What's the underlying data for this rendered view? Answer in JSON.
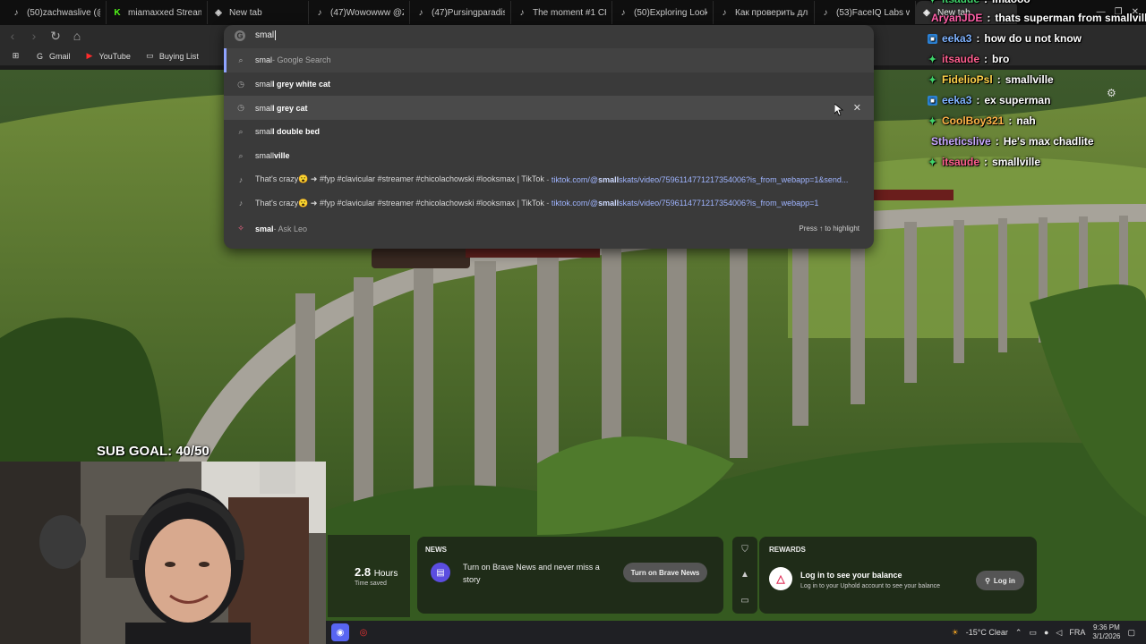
{
  "tabs": [
    {
      "label": "(50)zachwaslive (@zac",
      "icon": "tiktok-icon"
    },
    {
      "label": "miamaxxed Stream - W",
      "icon": "kick-icon"
    },
    {
      "label": "New tab",
      "icon": "brave-icon"
    },
    {
      "label": "(47)Wowowww @Zeta",
      "icon": "tiktok-icon"
    },
    {
      "label": "(47)Pursingparadise (@",
      "icon": "tiktok-icon"
    },
    {
      "label": "The moment #1 CHAD",
      "icon": "tiktok-icon"
    },
    {
      "label": "(50)Exploring Looks M",
      "icon": "tiktok-icon"
    },
    {
      "label": "Как проверить длину",
      "icon": "tiktok-icon"
    },
    {
      "label": "(53)FaceIQ Labs w",
      "icon": "tiktok-icon"
    },
    {
      "label": "New tab",
      "icon": "brave-icon",
      "active": true
    }
  ],
  "bookmarks": [
    {
      "label": "Gmail",
      "icon": "google-icon"
    },
    {
      "label": "YouTube",
      "icon": "youtube-icon"
    },
    {
      "label": "Buying List",
      "icon": "folder-icon"
    }
  ],
  "omnibox": {
    "value": "smal",
    "suggestions": [
      {
        "icon": "search-icon",
        "typed": "smal",
        "bold": "",
        "desc": " - Google Search"
      },
      {
        "icon": "history-icon",
        "typed": "smal",
        "bold": "l grey white cat",
        "desc": ""
      },
      {
        "icon": "history-icon",
        "typed": "smal",
        "bold": "l grey cat",
        "desc": ""
      },
      {
        "icon": "search-icon",
        "typed": "smal",
        "bold": "l double bed",
        "desc": ""
      },
      {
        "icon": "search-icon",
        "typed": "small",
        "bold": "ville",
        "desc": ""
      },
      {
        "icon": "tiktok-icon",
        "title": "That's crazy😮 ➜ #fyp #clavicular #streamer #chicolachowski #looksmax | TikTok",
        "url_pre": "tiktok.com/@",
        "url_bold": "small",
        "url_post": "skats/video/7596114771217354006?is_from_webapp=1&send..."
      },
      {
        "icon": "tiktok-icon",
        "title": "That's crazy😮 ➜ #fyp #clavicular #streamer #chicolachowski #looksmax | TikTok",
        "url_pre": "tiktok.com/@",
        "url_bold": "small",
        "url_post": "skats/video/7596114771217354006?is_from_webapp=1"
      },
      {
        "icon": "leo-icon",
        "typed": "smal",
        "bold": "",
        "desc": " - Ask Leo",
        "hint": "Press ↑ to highlight"
      }
    ]
  },
  "chat": [
    {
      "user": "itsaude",
      "text": "lmaooo",
      "color": "#3fd46a",
      "badge": "star"
    },
    {
      "user": "AryanJDE",
      "text": "thats superman from smallville",
      "color": "#ff5fa8",
      "badge": ""
    },
    {
      "user": "eeka3",
      "text": "how do u not know",
      "color": "#7fb3ff",
      "badge": "square"
    },
    {
      "user": "itsaude",
      "text": "bro",
      "color": "#ff5f8f",
      "badge": "star"
    },
    {
      "user": "FidelioPsl",
      "text": "smallville",
      "color": "#ffd24a",
      "badge": "star"
    },
    {
      "user": "eeka3",
      "text": "ex superman",
      "color": "#7fb3ff",
      "badge": "square"
    },
    {
      "user": "CoolBoy321",
      "text": "nah",
      "color": "#ffb347",
      "badge": "star"
    },
    {
      "user": "Stheticslive",
      "text": "He's max chadlite",
      "color": "#c8a8ff",
      "badge": ""
    },
    {
      "user": "itsaude",
      "text": "smallville",
      "color": "#ff5f8f",
      "badge": "star"
    }
  ],
  "overlay": {
    "sub_goal": "SUB GOAL: 40/50"
  },
  "stats": {
    "value": "2.8",
    "unit": "Hours",
    "label": "Time saved"
  },
  "news": {
    "title": "NEWS",
    "text": "Turn on Brave News and never miss a story",
    "button": "Turn on Brave News"
  },
  "rewards": {
    "title": "REWARDS",
    "headline": "Log in to see your balance",
    "subtext": "Log in to your Uphold account to see your balance",
    "button": "Log in"
  },
  "taskbar": {
    "weather": "-15°C  Clear",
    "lang": "FRA",
    "time": "9:36 PM",
    "date": "3/1/2026"
  },
  "colors": {
    "omnibox_bg": "#3a3a3a",
    "accent": "#8fa3ff",
    "url": "#9fb4ff"
  }
}
